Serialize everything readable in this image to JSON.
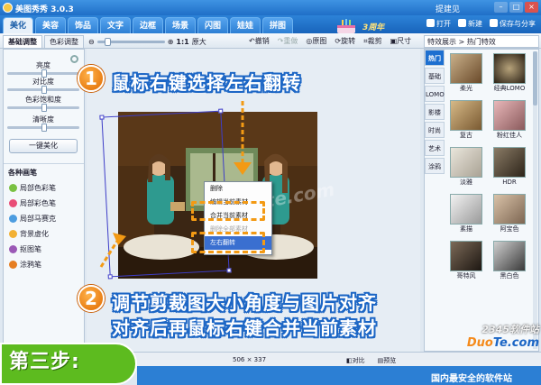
{
  "titlebar": {
    "title": "美图秀秀 3.0.3",
    "user": "提建见",
    "controls": [
      "–",
      "□",
      "×"
    ]
  },
  "tabs": [
    {
      "label": "美化",
      "active": true
    },
    {
      "label": "美容"
    },
    {
      "label": "饰品"
    },
    {
      "label": "文字"
    },
    {
      "label": "边框"
    },
    {
      "label": "场景"
    },
    {
      "label": "闪图"
    },
    {
      "label": "娃娃"
    },
    {
      "label": "拼图"
    }
  ],
  "anniversary": "3周年",
  "top_right": {
    "open": "打开",
    "new": "新建",
    "save_share": "保存与分享"
  },
  "subtabs": {
    "basic": "基础调整",
    "color": "色彩调整"
  },
  "zoom": {
    "ratio": "1:1",
    "original": "原大"
  },
  "edit_tools": {
    "undo": "撤销",
    "redo": "重做",
    "original_img": "原图",
    "rotate": "旋转",
    "crop": "裁剪",
    "size": "尺寸"
  },
  "right_header": "特效展示 > 热门特效",
  "sliders": [
    "亮度",
    "对比度",
    "色彩饱和度",
    "清晰度"
  ],
  "beautify_button": "一键美化",
  "brush": {
    "title": "各种画笔",
    "items": [
      "局部色彩笔",
      "局部彩色笔",
      "局部马赛克",
      "背景虚化",
      "抠图笔",
      "涂鸦笔"
    ],
    "colors": [
      "#7ac142",
      "#e94e77",
      "#4d9de0",
      "#f2b134",
      "#9b59b6",
      "#e67e22"
    ]
  },
  "context_menu": {
    "items": [
      "删除",
      "编辑当前素材",
      "合并当前素材",
      "左右翻转"
    ],
    "faded_item": "删除全部素材",
    "highlight_index": 3
  },
  "annotations": {
    "step1_num": "1",
    "step1_text": "鼠标右键选择左右翻转",
    "step2_num": "2",
    "step2_line1": "调节剪裁图大小角度与图片对齐",
    "step2_line2": "对齐后再鼠标右键合并当前素材",
    "watermark": "Duote.com"
  },
  "effect_categories": [
    "热门",
    "基础",
    "LOMO",
    "影楼",
    "时尚",
    "艺术",
    "涂鸦"
  ],
  "effects": [
    "柔光",
    "经典LOMO",
    "复古",
    "粉红佳人",
    "淡雅",
    "HDR",
    "素描",
    "阿宝色",
    "哥特风",
    "黑白色"
  ],
  "status": {
    "dimensions": "506 × 337",
    "compare": "对比",
    "preview": "预览"
  },
  "step_label": "第三步:",
  "site": {
    "cn": "2345软件站",
    "en_pre": "Duo",
    "en_post": "Te.com",
    "slogan": "国内最安全的软件站"
  },
  "colors": {
    "accent": "#1f6fc7",
    "annotation_orange": "#f39a14",
    "step_green": "#5dbb1f"
  }
}
